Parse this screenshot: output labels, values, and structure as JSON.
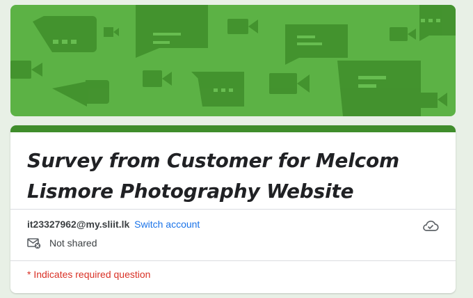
{
  "banner": {
    "accent_color": "#5cb245",
    "dark_shape_color": "#3f8d2b"
  },
  "form": {
    "title": "Survey from Customer for Melcom Lismore Photography Website",
    "account_email": "it23327962@my.sliit.lk",
    "switch_account": "Switch account",
    "shared_status": "Not shared",
    "required_note": "* Indicates required question"
  },
  "icons": {
    "not_shared": "envelope-slash-icon",
    "saved": "cloud-check-icon"
  }
}
